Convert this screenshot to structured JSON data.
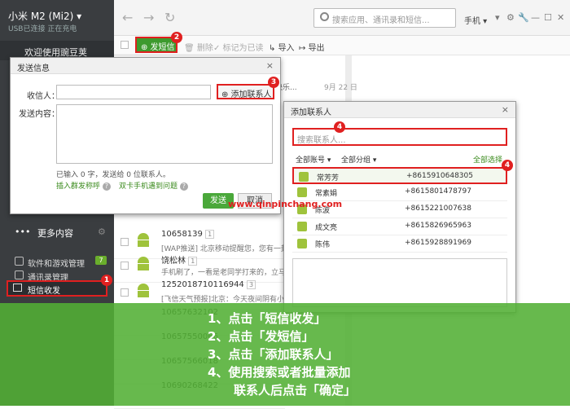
{
  "sidebar": {
    "title": "小米 M2 (Mi2) ▾",
    "status": "USB已连接  正在充电",
    "welcome": "欢迎使用豌豆荚",
    "items": [
      {
        "label": "软件和游戏管理",
        "badge": "7"
      },
      {
        "label": "通讯录管理"
      },
      {
        "label": "短信收发"
      }
    ],
    "more": "更多内容",
    "dots": "•••"
  },
  "topbar": {
    "back": "←",
    "forward": "→",
    "refresh": "↻",
    "search_placeholder": "搜索应用、通讯录和短信...",
    "phone_menu": "手机 ▾",
    "window_controls": [
      "▾",
      "⚙",
      "🔧",
      "—",
      "☐",
      "✕"
    ]
  },
  "toolbar": {
    "new_sms": "⊕ 发短信",
    "delete": "🗑 删除",
    "mark_read": "✓ 标记为已读",
    "import": "↳ 导入",
    "export": "↦ 导出"
  },
  "messages": [
    {
      "name": "10658139",
      "count": "1",
      "preview": "[WAP推送] 北京移动提醒您，您有一封..."
    },
    {
      "name": "饶松林",
      "count": "1",
      "preview": "手机刷了，一看是老同学打来的，立马接..."
    },
    {
      "name": "1252018710116944",
      "count": "3",
      "preview": "[飞信天气预报]北京：今天夜间阴有小中..."
    },
    {
      "name": "10657632102",
      "count": "",
      "preview": ""
    },
    {
      "name": "10657550066",
      "count": "",
      "preview": ""
    },
    {
      "name": "10657566018",
      "count": "",
      "preview": ""
    },
    {
      "name": "10690268422",
      "count": "",
      "preview": ""
    }
  ],
  "bg_snippet": {
    "text": "快乐...",
    "date": "9月 22 日"
  },
  "send_dialog": {
    "title": "发送信息",
    "close": "×",
    "to_label": "收信人：",
    "add_contact": "⊕ 添加联系人",
    "content_label": "发送内容：",
    "counter": "已输入 0 字，发送给 0 位联系人。",
    "link_insert": "插入群发称呼",
    "link_help": "双卡手机遇到问题",
    "help_icon": "?",
    "send": "发送",
    "cancel": "取消"
  },
  "add_dialog": {
    "title": "添加联系人",
    "close": "×",
    "search_placeholder": "搜索联系人...",
    "filter_account": "全部账号 ▾",
    "filter_group": "全部分组 ▾",
    "select_all": "全部选择",
    "contacts": [
      {
        "name": "常芳芳",
        "phone": "+8615910648305"
      },
      {
        "name": "常素娟",
        "phone": "+8615801478797"
      },
      {
        "name": "陈波",
        "phone": "+8615221007638"
      },
      {
        "name": "成文亮",
        "phone": "+8615826965963"
      },
      {
        "name": "陈伟",
        "phone": "+8615928891969"
      }
    ]
  },
  "markers": [
    "1",
    "2",
    "3",
    "4",
    "4"
  ],
  "watermark": "www.qinpinchang.com",
  "steps": [
    "1、点击「短信收发」",
    "2、点击「发短信」",
    "3、点击「添加联系人」",
    "4、使用搜索或者批量添加",
    "联系人后点击「确定」"
  ],
  "colors": {
    "accent_green": "#3d9a2e",
    "marker_red": "#e02020",
    "sidebar": "#3a3d40",
    "overlay": "#52af34"
  }
}
